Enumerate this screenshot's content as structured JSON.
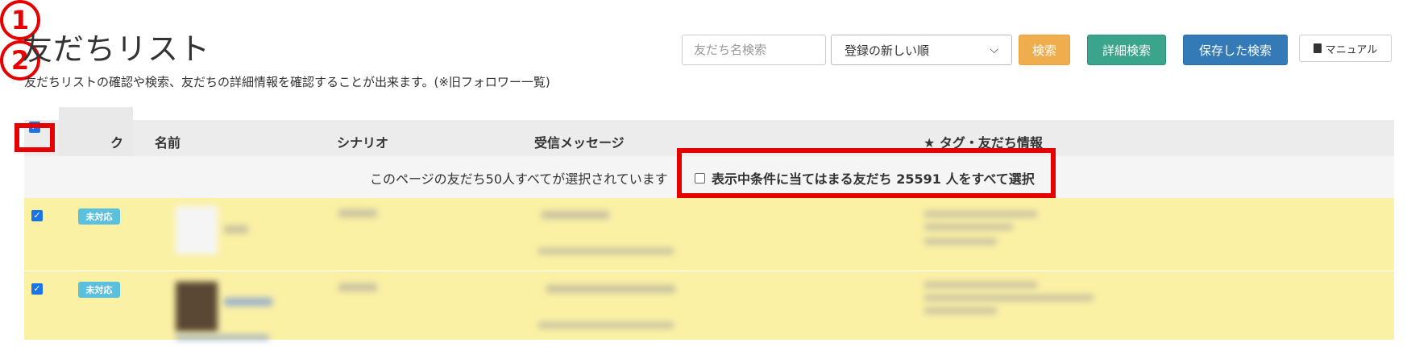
{
  "page": {
    "title": "友だちリスト",
    "description": "友だちリストの確認や検索、友だちの詳細情報を確認することが出来ます。(※旧フォロワー一覧)"
  },
  "toolbar": {
    "search_placeholder": "友だち名検索",
    "sort_selected": "登録の新しい順",
    "search_label": "検索",
    "detail_search_label": "詳細検索",
    "saved_search_label": "保存した検索",
    "manual_label": "マニュアル"
  },
  "table": {
    "columns": [
      "ク",
      "名前",
      "シナリオ",
      "受信メッセージ",
      "★ タグ・友だち情報"
    ],
    "notice": "このページの友だち50人すべてが選択されています",
    "select_all_label": "表示中条件に当てはまる友だち 25591 人をすべて選択",
    "rows": [
      {
        "status": "未対応",
        "checked": true
      },
      {
        "status": "未対応",
        "checked": true
      }
    ]
  },
  "annotations": {
    "step1": "1",
    "step2": "2"
  },
  "colors": {
    "highlight_row": "#fbf1a5",
    "annotation_red": "#e60000",
    "badge": "#5bc0de"
  }
}
